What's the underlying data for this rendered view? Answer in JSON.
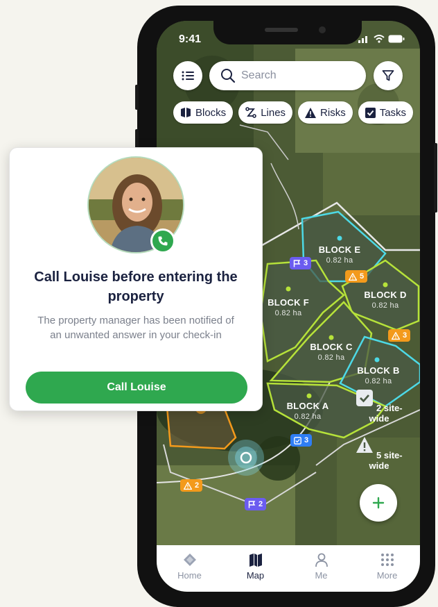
{
  "status": {
    "time": "9:41"
  },
  "search": {
    "placeholder": "Search"
  },
  "chips": {
    "blocks": "Blocks",
    "lines": "Lines",
    "risks": "Risks",
    "tasks": "Tasks"
  },
  "blocks": [
    {
      "name": "BLOCK E",
      "area": "0.82 ha"
    },
    {
      "name": "BLOCK D",
      "area": "0.82 ha"
    },
    {
      "name": "BLOCK F",
      "area": "0.82 ha"
    },
    {
      "name": "BLOCK C",
      "area": "0.82 ha"
    },
    {
      "name": "BLOCK B",
      "area": "0.82 ha"
    },
    {
      "name": "BLOCK A",
      "area": "0.82 ha"
    }
  ],
  "badges": {
    "flag_block_e": "3",
    "risk_block_d": "5",
    "risk_block_b": "3",
    "task_block_a": "3",
    "risk_bottom": "2",
    "flag_bottom": "2"
  },
  "site_wide": {
    "tasks": "2 site-wide",
    "risks": "5 site-wide"
  },
  "tabs": {
    "home": "Home",
    "map": "Map",
    "me": "Me",
    "more": "More"
  },
  "card": {
    "title": "Call Louise before entering the property",
    "body": "The property manager has been notified of an unwanted answer in your check-in",
    "button": "Call Louise"
  },
  "colors": {
    "accent": "#2fa84f",
    "navy": "#1b2240",
    "flag": "#6b5cf0",
    "risk": "#f39a1c",
    "task": "#2f7ef5"
  }
}
